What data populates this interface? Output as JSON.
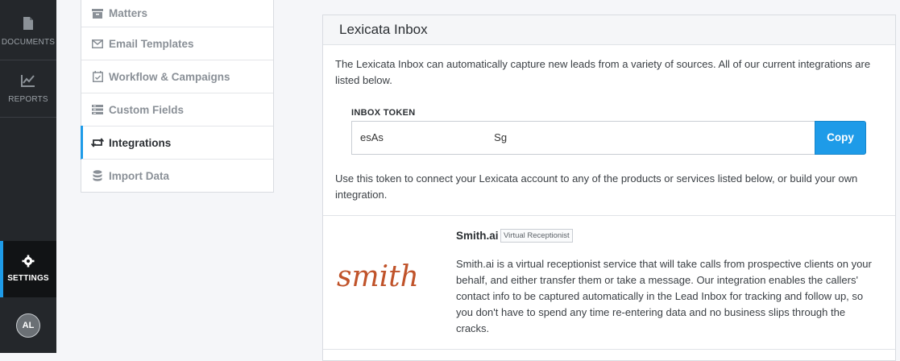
{
  "rail": {
    "documents_label": "DOCUMENTS",
    "reports_label": "REPORTS",
    "settings_label": "SETTINGS",
    "avatar_initials": "AL"
  },
  "menu": {
    "items": [
      {
        "label": "Matters",
        "icon": "archive-icon"
      },
      {
        "label": "Email Templates",
        "icon": "envelope-icon"
      },
      {
        "label": "Workflow & Campaigns",
        "icon": "calendar-check-icon"
      },
      {
        "label": "Custom Fields",
        "icon": "list-icon"
      },
      {
        "label": "Integrations",
        "icon": "retweet-icon",
        "active": true
      },
      {
        "label": "Import Data",
        "icon": "database-icon"
      }
    ]
  },
  "panel": {
    "title": "Lexicata Inbox",
    "intro": "The Lexicata Inbox can automatically capture new leads from a variety of sources. All of our current integrations are listed below.",
    "token_label": "INBOX TOKEN",
    "token_value": "esAs                                      Sg",
    "copy_label": "Copy",
    "token_note": "Use this token to connect your Lexicata account to any of the products or services listed below, or build your own integration."
  },
  "integration": {
    "logo_text": "smith",
    "name": "Smith.ai",
    "badge": "Virtual Receptionist",
    "description": "Smith.ai is a virtual receptionist service that will take calls from prospective clients on your behalf, and either transfer them or take a message. Our integration enables the callers' contact info to be captured automatically in the Lead Inbox for tracking and follow up, so you don't have to spend any time re-entering data and no business slips through the cracks.",
    "logo_color": "#c0532a"
  },
  "colors": {
    "accent": "#1e9be8",
    "rail_bg": "#24272b"
  }
}
